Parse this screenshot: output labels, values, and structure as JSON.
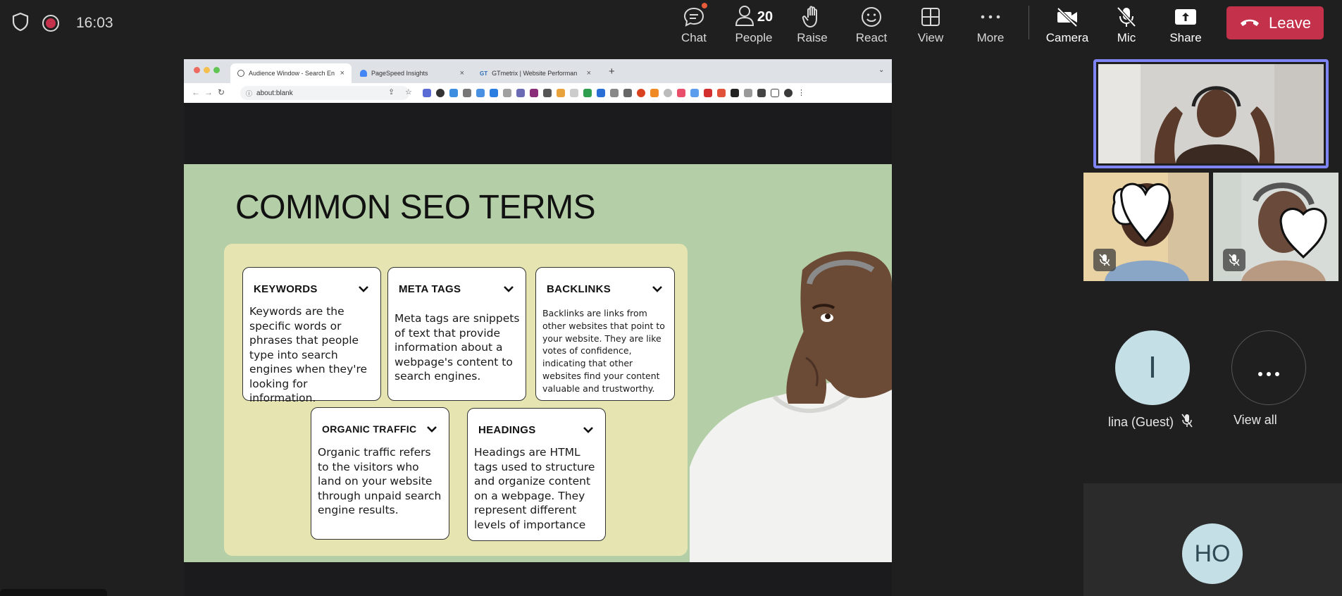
{
  "meeting": {
    "time": "16:03",
    "toolbar": {
      "chat": "Chat",
      "people": "People",
      "people_count": "20",
      "raise": "Raise",
      "react": "React",
      "view": "View",
      "more": "More",
      "camera": "Camera",
      "mic": "Mic",
      "share": "Share",
      "leave": "Leave"
    }
  },
  "browser": {
    "tabs": [
      {
        "label": "Audience Window - Search En"
      },
      {
        "label": "PageSpeed Insights"
      },
      {
        "label": "GTmetrix | Website Performan"
      }
    ],
    "new_tab": "+",
    "url": "about:blank"
  },
  "slide": {
    "title": "COMMON SEO TERMS",
    "terms": [
      {
        "title": "KEYWORDS",
        "body": "Keywords are the specific words or phrases that people type into search engines when they're looking for information."
      },
      {
        "title": "META TAGS",
        "body": "Meta tags are snippets of text that provide information about a webpage's content to search engines."
      },
      {
        "title": "BACKLINKS",
        "body": "Backlinks are links from other websites that point to your website. They are like votes of confidence, indicating that other websites find your content valuable and trustworthy."
      },
      {
        "title": "ORGANIC TRAFFIC",
        "body": "Organic traffic refers to the visitors who land on your website through unpaid search engine results."
      },
      {
        "title": "HEADINGS",
        "body": "Headings are HTML tags used to structure and organize content on a webpage. They represent different levels of importance"
      }
    ]
  },
  "participants": {
    "guest_initial": "I",
    "guest_name": "lina (Guest)",
    "view_all": "View all",
    "ho_initials": "HO"
  },
  "colors": {
    "leave": "#c4314b",
    "spotlight_border": "#7f85f5",
    "slide_bg": "#b4cfa8",
    "card_panel": "#e6e5b1"
  }
}
